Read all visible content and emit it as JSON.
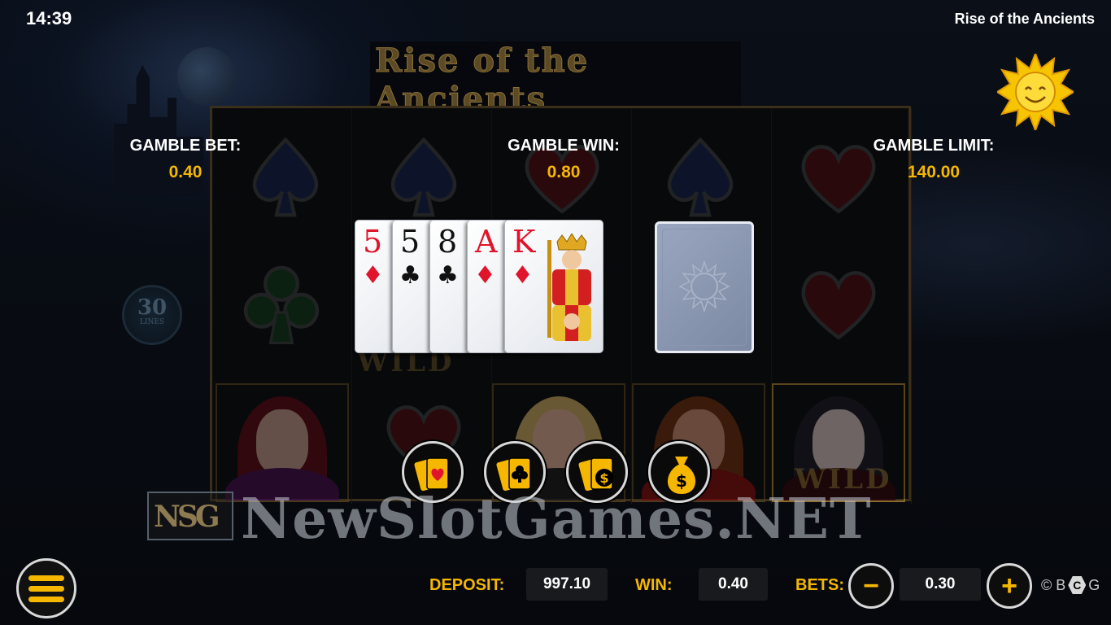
{
  "status_bar": {
    "time": "14:39",
    "game_title": "Rise of the Ancients"
  },
  "logo": {
    "text": "Rise of the Ancients"
  },
  "lines_badge": {
    "number": "30",
    "label": "LINES"
  },
  "gamble": {
    "bet_label": "GAMBLE BET:",
    "bet_value": "0.40",
    "win_label": "GAMBLE WIN:",
    "win_value": "0.80",
    "limit_label": "GAMBLE LIMIT:",
    "limit_value": "140.00"
  },
  "card_history": [
    {
      "rank": "5",
      "suit": "♦",
      "color": "red"
    },
    {
      "rank": "5",
      "suit": "♣",
      "color": "black"
    },
    {
      "rank": "8",
      "suit": "♣",
      "color": "black"
    },
    {
      "rank": "A",
      "suit": "♦",
      "color": "red"
    },
    {
      "rank": "K",
      "suit": "♦",
      "color": "red"
    }
  ],
  "choices": [
    {
      "name": "red-cards-icon"
    },
    {
      "name": "black-cards-icon"
    },
    {
      "name": "half-gamble-icon"
    },
    {
      "name": "collect-money-bag-icon"
    }
  ],
  "reel_wild_text": "WILD",
  "watermark": {
    "mark": "NSG",
    "text": "NewSlotGames.NET"
  },
  "bottom_bar": {
    "deposit_label": "DEPOSIT:",
    "deposit_value": "997.10",
    "win_label": "WIN:",
    "win_value": "0.40",
    "bets_label": "BETS:",
    "bets_value": "0.30",
    "minus": "−",
    "plus": "+",
    "copyright": "© B",
    "brand_mark": "C",
    "brand_tail": "G"
  },
  "colors": {
    "accent": "#f5b700",
    "red_suit": "#e0142b"
  }
}
